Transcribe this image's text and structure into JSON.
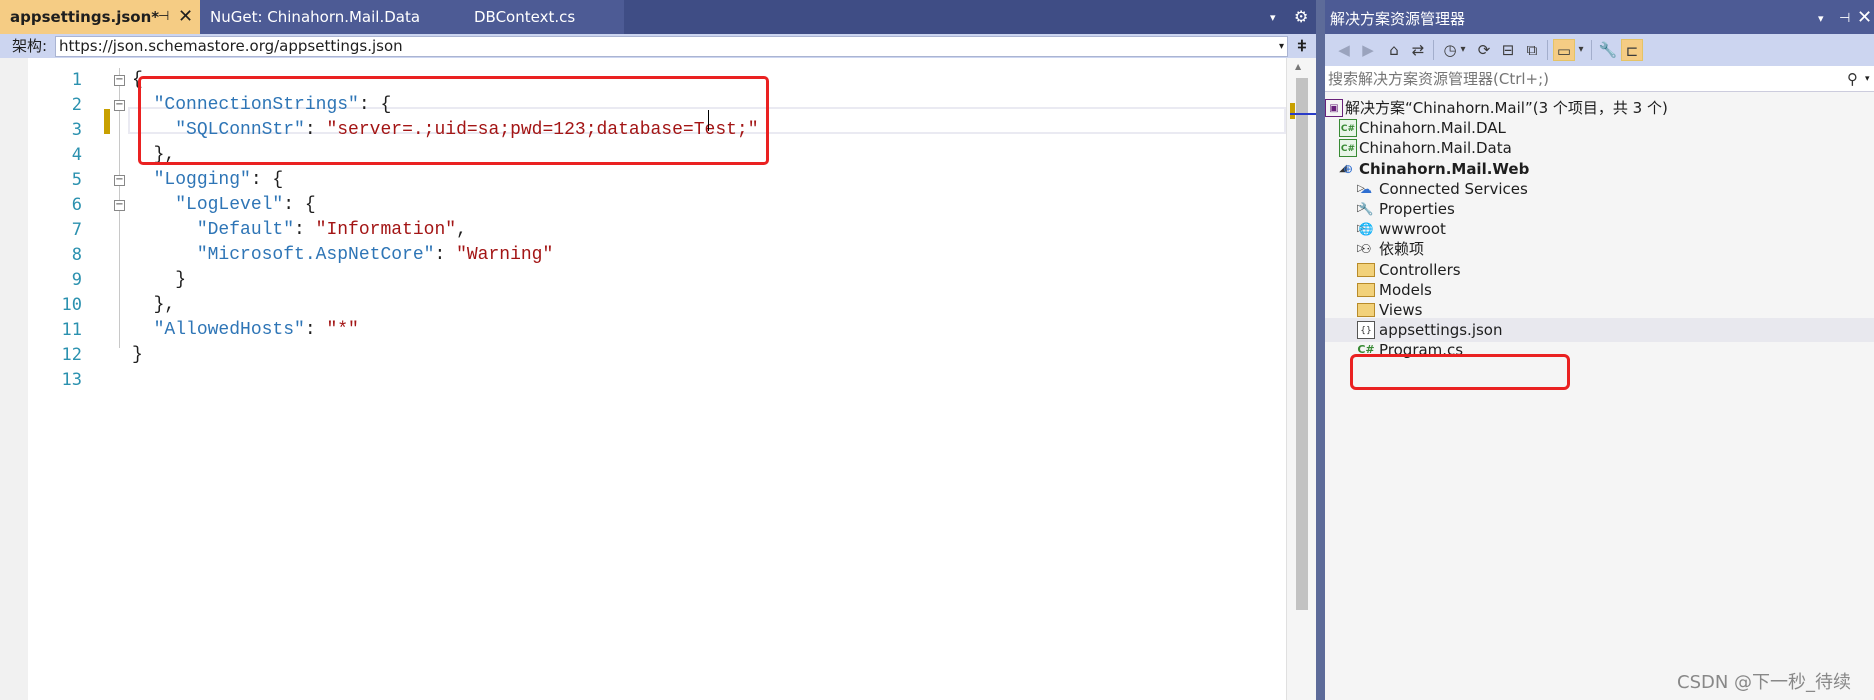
{
  "editor": {
    "tabs": [
      {
        "label": "appsettings.json*",
        "active": true,
        "pin_icon": "⊣",
        "close_icon": "✕"
      },
      {
        "label": "NuGet: Chinahorn.Mail.Data"
      },
      {
        "label": "DBContext.cs"
      }
    ],
    "tab_overflow_icon": "▾",
    "tab_settings_icon": "⚙",
    "schema": {
      "label": "架构:",
      "url": "https://json.schemastore.org/appsettings.json",
      "dropdown_icon": "▾",
      "split_icon": "⧧"
    },
    "line_numbers": [
      "1",
      "2",
      "3",
      "4",
      "5",
      "6",
      "7",
      "8",
      "9",
      "10",
      "11",
      "12",
      "13"
    ],
    "code_lines": [
      [
        {
          "t": "{",
          "c": "p"
        }
      ],
      [
        {
          "t": "  ",
          "c": "p"
        },
        {
          "t": "\"ConnectionStrings\"",
          "c": "k"
        },
        {
          "t": ": {",
          "c": "p"
        }
      ],
      [
        {
          "t": "    ",
          "c": "p"
        },
        {
          "t": "\"SQLConnStr\"",
          "c": "k"
        },
        {
          "t": ": ",
          "c": "p"
        },
        {
          "t": "\"server=.;uid=sa;pwd=123;database=Test;\"",
          "c": "s"
        }
      ],
      [
        {
          "t": "  },",
          "c": "p"
        }
      ],
      [
        {
          "t": "  ",
          "c": "p"
        },
        {
          "t": "\"Logging\"",
          "c": "k"
        },
        {
          "t": ": {",
          "c": "p"
        }
      ],
      [
        {
          "t": "    ",
          "c": "p"
        },
        {
          "t": "\"LogLevel\"",
          "c": "k"
        },
        {
          "t": ": {",
          "c": "p"
        }
      ],
      [
        {
          "t": "      ",
          "c": "p"
        },
        {
          "t": "\"Default\"",
          "c": "k"
        },
        {
          "t": ": ",
          "c": "p"
        },
        {
          "t": "\"Information\"",
          "c": "s"
        },
        {
          "t": ",",
          "c": "p"
        }
      ],
      [
        {
          "t": "      ",
          "c": "p"
        },
        {
          "t": "\"Microsoft.AspNetCore\"",
          "c": "k"
        },
        {
          "t": ": ",
          "c": "p"
        },
        {
          "t": "\"Warning\"",
          "c": "s"
        }
      ],
      [
        {
          "t": "    }",
          "c": "p"
        }
      ],
      [
        {
          "t": "  },",
          "c": "p"
        }
      ],
      [
        {
          "t": "  ",
          "c": "p"
        },
        {
          "t": "\"AllowedHosts\"",
          "c": "k"
        },
        {
          "t": ": ",
          "c": "p"
        },
        {
          "t": "\"*\"",
          "c": "s"
        }
      ],
      [
        {
          "t": "}",
          "c": "p"
        }
      ],
      []
    ],
    "fold_symbol": "−",
    "fold_lines": [
      1,
      2,
      5,
      6
    ]
  },
  "solution_explorer": {
    "title": "解决方案资源管理器",
    "title_drop_icon": "▾",
    "title_pin_icon": "⊣",
    "title_close_icon": "✕",
    "toolbar_icons": {
      "back": "◀",
      "forward": "▶",
      "home": "⌂",
      "switch_views": "⇄",
      "history": "◷",
      "history_drop": "▾",
      "sync": "⟳",
      "collapse": "⊟",
      "show_all": "⧉",
      "preview": "▭",
      "preview_drop": "▾",
      "properties": "🔧",
      "pending": "⊏"
    },
    "search_placeholder": "搜索解决方案资源管理器(Ctrl+;)",
    "search_icon": "⚲",
    "search_drop_icon": "▾",
    "tree": [
      {
        "label": "解决方案“Chinahorn.Mail”(3 个项目，共 3 个)",
        "icon": "solution-icon",
        "glyph": "▣",
        "icon_class": "ico-sln",
        "expander": "",
        "level": 0,
        "bold": false
      },
      {
        "label": "Chinahorn.Mail.DAL",
        "icon": "csharp-project-icon",
        "glyph": "C#",
        "icon_class": "ico-csproj",
        "expander": "▷",
        "level": 1,
        "bold": false
      },
      {
        "label": "Chinahorn.Mail.Data",
        "icon": "csharp-project-icon",
        "glyph": "C#",
        "icon_class": "ico-csproj",
        "expander": "▷",
        "level": 1,
        "bold": false
      },
      {
        "label": "Chinahorn.Mail.Web",
        "icon": "web-project-icon",
        "glyph": "⊕",
        "icon_class": "ico-web",
        "expander": "◢",
        "level": 1,
        "bold": true
      },
      {
        "label": "Connected Services",
        "icon": "connected-services-icon",
        "glyph": "☁",
        "icon_class": "ico-web",
        "expander": "▷",
        "level": 2,
        "bold": false
      },
      {
        "label": "Properties",
        "icon": "wrench-icon",
        "glyph": "🔧",
        "icon_class": "",
        "expander": "▷",
        "level": 2,
        "bold": false
      },
      {
        "label": "wwwroot",
        "icon": "globe-icon",
        "glyph": "🌐",
        "icon_class": "ico-web",
        "expander": "▷",
        "level": 2,
        "bold": false
      },
      {
        "label": "依赖项",
        "icon": "dependencies-icon",
        "glyph": "⚇",
        "icon_class": "",
        "expander": "▷",
        "level": 2,
        "bold": false
      },
      {
        "label": "Controllers",
        "icon": "folder-icon",
        "glyph": "",
        "icon_class": "ico-folder",
        "expander": "▷",
        "level": 2,
        "bold": false
      },
      {
        "label": "Models",
        "icon": "folder-icon",
        "glyph": "",
        "icon_class": "ico-folder",
        "expander": "▷",
        "level": 2,
        "bold": false
      },
      {
        "label": "Views",
        "icon": "folder-icon",
        "glyph": "",
        "icon_class": "ico-folder",
        "expander": "▷",
        "level": 2,
        "bold": false
      },
      {
        "label": "appsettings.json",
        "icon": "json-file-icon",
        "glyph": "{}",
        "icon_class": "ico-json",
        "expander": "▷",
        "level": 2,
        "bold": false
      },
      {
        "label": "Program.cs",
        "icon": "csharp-file-icon",
        "glyph": "C#",
        "icon_class": "ico-cs",
        "expander": "",
        "level": 2,
        "bold": false
      }
    ]
  },
  "watermark": "CSDN @下一秒_待续",
  "colors": {
    "accent_tab": "#f5cc84",
    "title_bar": "#4d5b95",
    "annotation_red": "#ea2121",
    "json_key": "#2e75b6",
    "json_string": "#a31515"
  }
}
